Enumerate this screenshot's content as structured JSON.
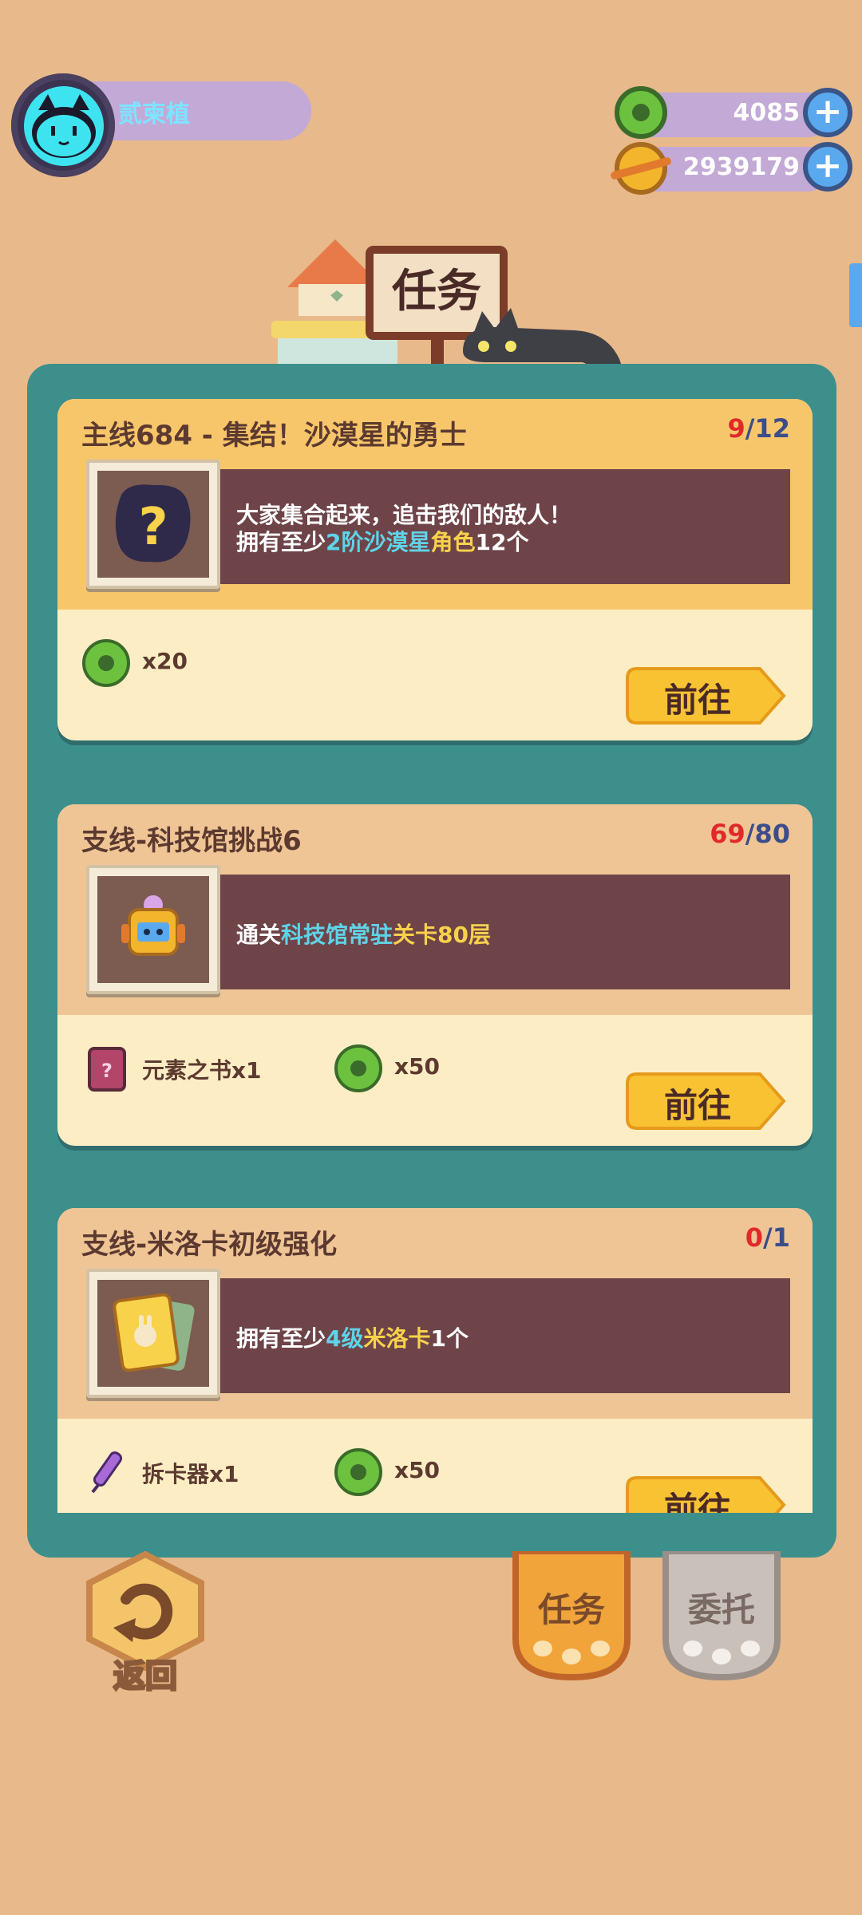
{
  "profile": {
    "name": "贰柬植"
  },
  "currencies": [
    {
      "icon": "green-donut-coin-icon",
      "value": "4085"
    },
    {
      "icon": "gold-planet-coin-icon",
      "value": "2939179"
    }
  ],
  "header": {
    "title": "任务"
  },
  "quests": [
    {
      "title": "主线684 - 集结！沙漠星的勇士",
      "progress_current": "9",
      "progress_sep": "/",
      "progress_total": "12",
      "icon": "mystery-question-icon",
      "desc_line1": "大家集合起来，追击我们的敌人！",
      "desc_line2": [
        {
          "text": "拥有至少",
          "hl": ""
        },
        {
          "text": "2阶",
          "hl": "cyan"
        },
        {
          "text": "沙漠星",
          "hl": "cyan"
        },
        {
          "text": "角色",
          "hl": "yellow"
        },
        {
          "text": "12个",
          "hl": ""
        }
      ],
      "rewards": [
        {
          "icon": "green-donut-coin-icon",
          "label": "x20"
        }
      ],
      "button": "前往",
      "header_color": "#f8c66a"
    },
    {
      "title": "支线-科技馆挑战6",
      "progress_current": "69",
      "progress_sep": "/",
      "progress_total": "80",
      "icon": "robot-icon",
      "desc_line1": "",
      "desc_line2": [
        {
          "text": "通关",
          "hl": ""
        },
        {
          "text": "科技馆常驻",
          "hl": "cyan"
        },
        {
          "text": "关卡80层",
          "hl": "yellow"
        }
      ],
      "rewards": [
        {
          "icon": "element-book-icon",
          "label": "元素之书x1"
        },
        {
          "icon": "green-donut-coin-icon",
          "label": "x50"
        }
      ],
      "button": "前往",
      "header_color": "#f0c595"
    },
    {
      "title": "支线-米洛卡初级强化",
      "progress_current": "0",
      "progress_sep": "/",
      "progress_total": "1",
      "icon": "bunny-card-icon",
      "desc_line1": "",
      "desc_line2": [
        {
          "text": "拥有至少",
          "hl": ""
        },
        {
          "text": "4级",
          "hl": "cyan"
        },
        {
          "text": "米洛卡",
          "hl": "yellow"
        },
        {
          "text": "1个",
          "hl": ""
        }
      ],
      "rewards": [
        {
          "icon": "card-splitter-icon",
          "label": "拆卡器x1"
        },
        {
          "icon": "green-donut-coin-icon",
          "label": "x50"
        }
      ],
      "button": "前往",
      "header_color": "#f0c595"
    }
  ],
  "bottom": {
    "back_label": "返回",
    "tab_quests": "任务",
    "tab_commission": "委托"
  }
}
